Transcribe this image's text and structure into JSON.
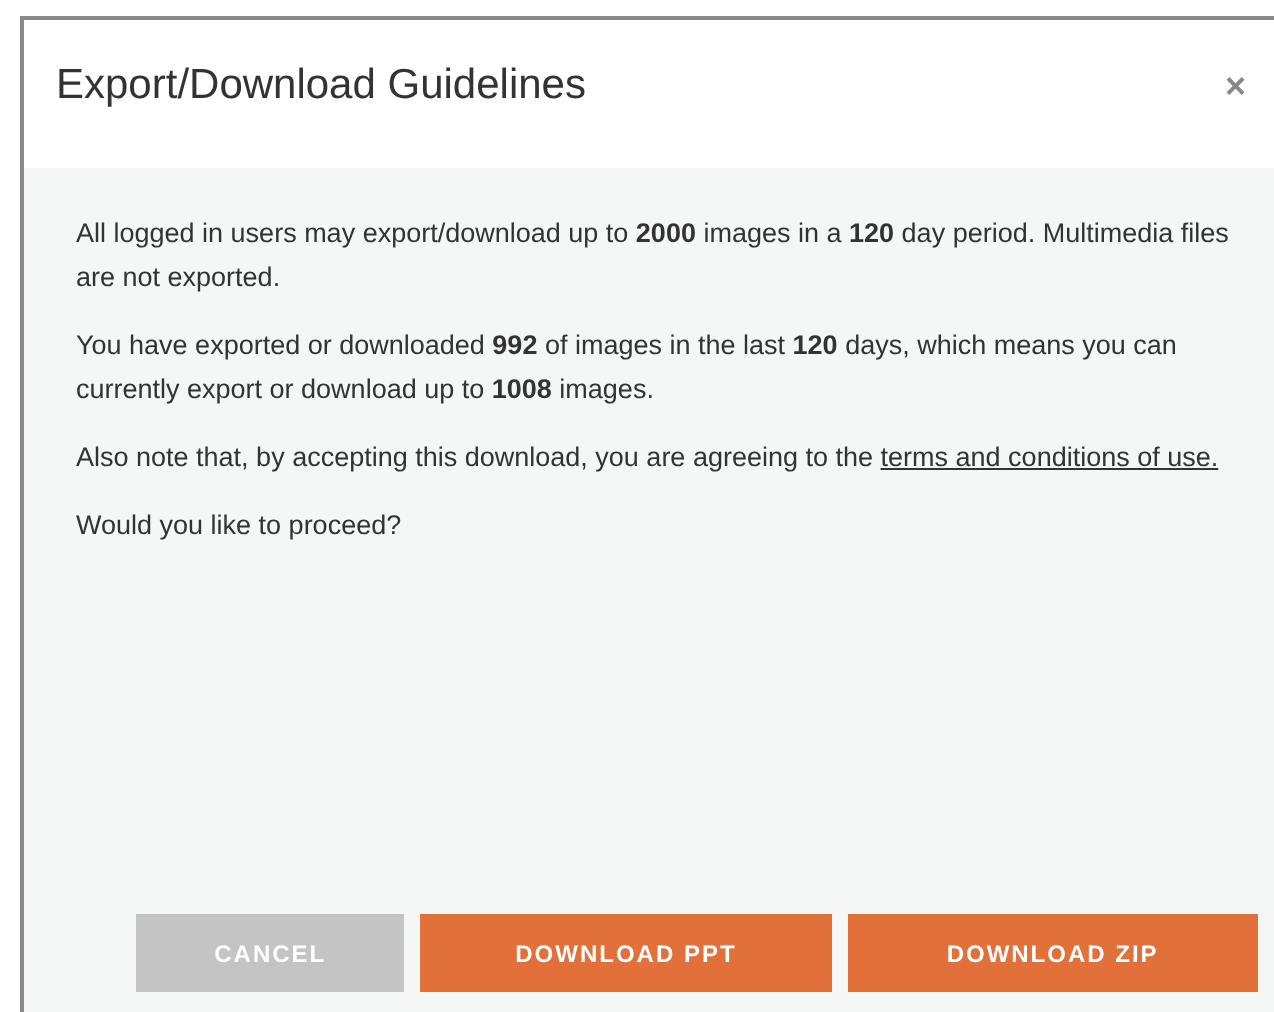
{
  "dialog": {
    "title": "Export/Download Guidelines",
    "close": "×"
  },
  "paragraphs": [
    {
      "text": "All logged in users may export/download up to **2000** images in a **120** day period. Multimedia files are not exported."
    },
    {
      "text": "You have exported or downloaded **992** of images in the last **120** days, which means you can currently export or download up to **1008** images."
    },
    {
      "text": "Also note that, by accepting this download, you are agreeing to the",
      "link": "terms and conditions of use."
    },
    {
      "text": "Would you like to proceed?"
    }
  ],
  "buttons": [
    {
      "label": "CANCEL",
      "disabled": true
    },
    {
      "label": "DOWNLOAD PPT",
      "disabled": false
    },
    {
      "label": "DOWNLOAD ZIP",
      "disabled": false
    }
  ]
}
